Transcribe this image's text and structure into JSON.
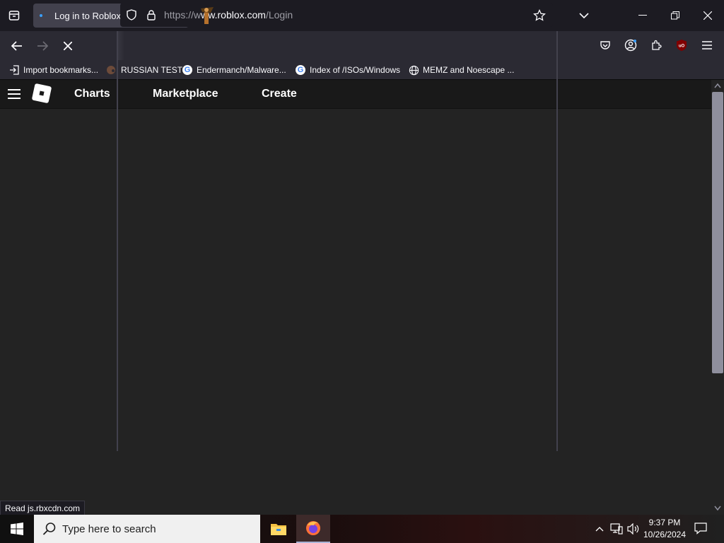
{
  "tab": {
    "title": "Log in to Roblox"
  },
  "urlbar": {
    "prefix": "https://",
    "mid": "w",
    "host": "ww.roblox.com",
    "path": "/Login"
  },
  "bookmarks": [
    {
      "label": "Import bookmarks...",
      "icon": "import-icon"
    },
    {
      "label": "RUSSIAN TEST",
      "icon": "pig-icon"
    },
    {
      "label": "Endermanch/Malware...",
      "icon": "google-icon"
    },
    {
      "label": "Index of /ISOs/Windows",
      "icon": "google-icon"
    },
    {
      "label": "MEMZ and Noescape ...",
      "icon": "globe-icon"
    }
  ],
  "roblox_nav": {
    "charts": "Charts",
    "marketplace": "Marketplace",
    "create": "Create"
  },
  "status": {
    "text": "Read js.rbxcdn.com"
  },
  "taskbar": {
    "search_placeholder": "Type here to search",
    "time": "9:37 PM",
    "date": "10/26/2024"
  },
  "colors": {
    "accent": "#3aa0ff",
    "ublock": "#800000"
  }
}
